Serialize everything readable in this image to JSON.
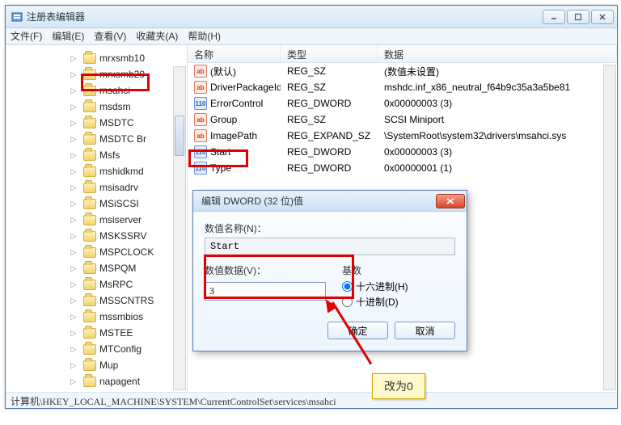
{
  "title": "注册表编辑器",
  "menu": [
    "文件(F)",
    "编辑(E)",
    "查看(V)",
    "收藏夹(A)",
    "帮助(H)"
  ],
  "tree": [
    "mrxsmb10",
    "mrxsmb20",
    "msahci",
    "msdsm",
    "MSDTC",
    "MSDTC Br",
    "Msfs",
    "mshidkmd",
    "msisadrv",
    "MSiSCSI",
    "msiserver",
    "MSKSSRV",
    "MSPCLOCK",
    "MSPQM",
    "MsRPC",
    "MSSCNTRS",
    "mssmbios",
    "MSTEE",
    "MTConfig",
    "Mup",
    "napagent"
  ],
  "tree_selected_index": 2,
  "list": {
    "headers": {
      "name": "名称",
      "type": "类型",
      "data": "数据"
    },
    "rows": [
      {
        "icon": "sz",
        "name": "(默认)",
        "type": "REG_SZ",
        "data": "(数值未设置)"
      },
      {
        "icon": "sz",
        "name": "DriverPackageId",
        "type": "REG_SZ",
        "data": "mshdc.inf_x86_neutral_f64b9c35a3a5be81"
      },
      {
        "icon": "dw",
        "name": "ErrorControl",
        "type": "REG_DWORD",
        "data": "0x00000003 (3)"
      },
      {
        "icon": "sz",
        "name": "Group",
        "type": "REG_SZ",
        "data": "SCSI Miniport"
      },
      {
        "icon": "sz",
        "name": "ImagePath",
        "type": "REG_EXPAND_SZ",
        "data": "\\SystemRoot\\system32\\drivers\\msahci.sys"
      },
      {
        "icon": "dw",
        "name": "Start",
        "type": "REG_DWORD",
        "data": "0x00000003 (3)"
      },
      {
        "icon": "dw",
        "name": "Type",
        "type": "REG_DWORD",
        "data": "0x00000001 (1)"
      }
    ]
  },
  "dialog": {
    "title": "编辑 DWORD (32 位)值",
    "name_label": "数值名称(N)：",
    "name_value": "Start",
    "data_label": "数值数据(V)：",
    "data_value": "3",
    "base_label": "基数",
    "hex_label": "十六进制(H)",
    "dec_label": "十进制(D)",
    "base_selected": "hex",
    "ok": "确定",
    "cancel": "取消"
  },
  "callout": "改为0",
  "statusbar": "计算机\\HKEY_LOCAL_MACHINE\\SYSTEM\\CurrentControlSet\\services\\msahci"
}
